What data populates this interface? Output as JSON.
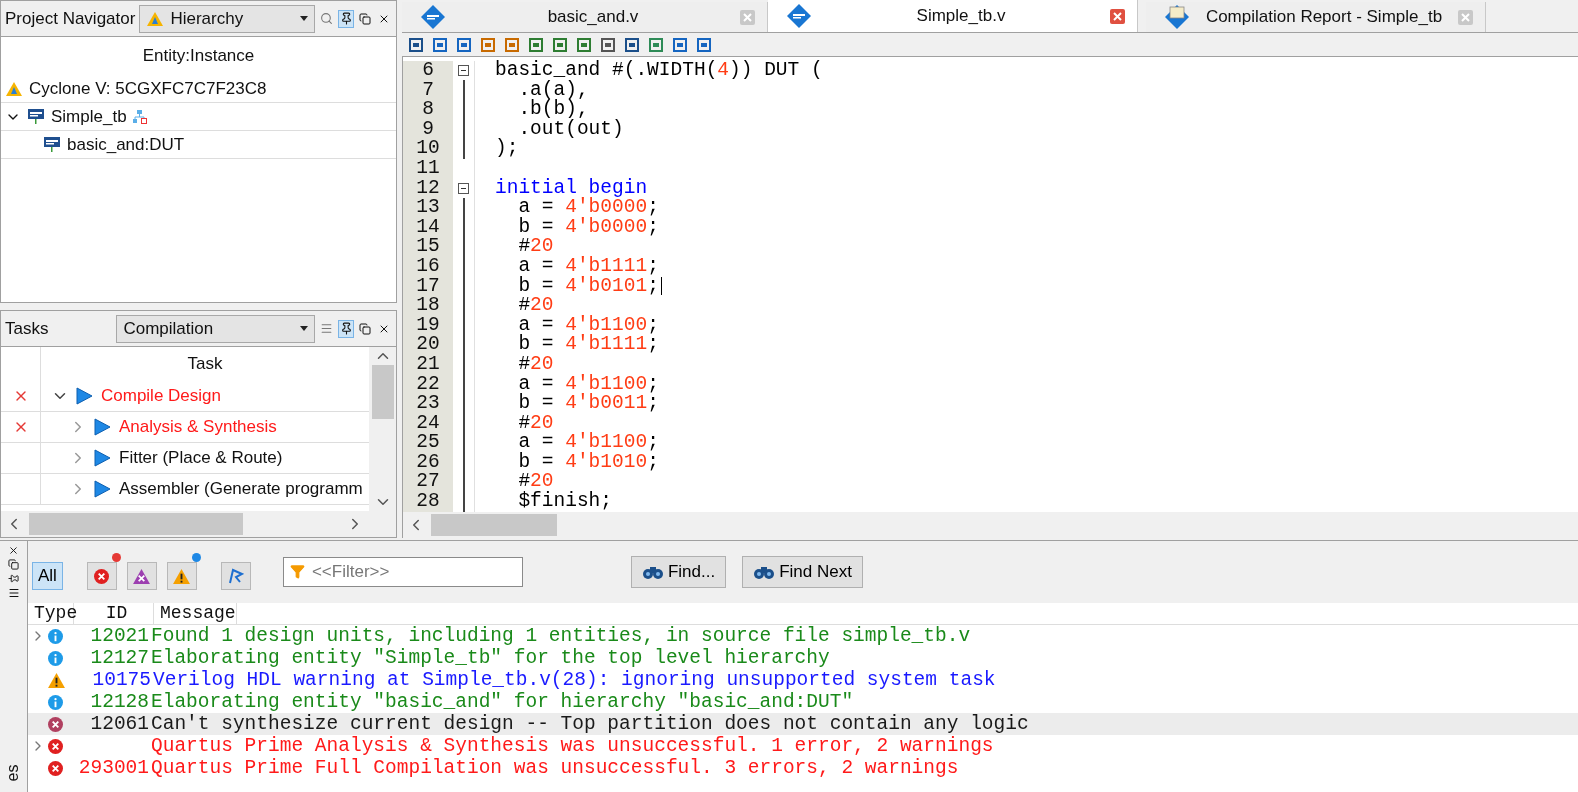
{
  "navigator": {
    "title": "Project Navigator",
    "view": "Hierarchy",
    "column": "Entity:Instance",
    "device": "Cyclone V: 5CGXFC7C7F23C8",
    "tree": [
      {
        "label": "Simple_tb",
        "expanded": true,
        "children": [
          {
            "label": "basic_and:DUT"
          }
        ]
      }
    ]
  },
  "tasks": {
    "title": "Tasks",
    "flow": "Compilation",
    "column": "Task",
    "tree": [
      {
        "label": "Compile Design",
        "failed": true,
        "expanded": true,
        "children": [
          {
            "label": "Analysis & Synthesis",
            "failed": true,
            "expanded": false
          },
          {
            "label": "Fitter (Place & Route)",
            "failed": false,
            "expanded": false
          },
          {
            "label": "Assembler (Generate programm",
            "failed": false,
            "expanded": false
          }
        ]
      }
    ]
  },
  "editor": {
    "tabs": [
      {
        "kind": "source",
        "label": "basic_and.v",
        "selected": false
      },
      {
        "kind": "source",
        "label": "Simple_tb.v",
        "selected": true
      },
      {
        "kind": "report",
        "label": "Compilation Report - Simple_tb",
        "selected": false
      }
    ],
    "lines": [
      {
        "number": "6",
        "kind": "start",
        "cursor": false,
        "tokens": [
          {
            "kind": "plain",
            "text": "basic_and #(.WIDTH("
          },
          {
            "kind": "number",
            "text": "4"
          },
          {
            "kind": "plain",
            "text": ")) DUT ("
          }
        ]
      },
      {
        "number": "7",
        "kind": "body",
        "cursor": false,
        "tokens": [
          {
            "kind": "plain",
            "text": "  .a(a),"
          }
        ]
      },
      {
        "number": "8",
        "kind": "body",
        "cursor": false,
        "tokens": [
          {
            "kind": "plain",
            "text": "  .b(b),"
          }
        ]
      },
      {
        "number": "9",
        "kind": "body",
        "cursor": false,
        "tokens": [
          {
            "kind": "plain",
            "text": "  .out(out)"
          }
        ]
      },
      {
        "number": "10",
        "kind": "body",
        "cursor": false,
        "tokens": [
          {
            "kind": "plain",
            "text": ");"
          }
        ]
      },
      {
        "number": "11",
        "kind": "none",
        "cursor": false
      },
      {
        "number": "12",
        "kind": "start",
        "cursor": false,
        "tokens": [
          {
            "kind": "keyword",
            "text": "initial begin"
          }
        ]
      },
      {
        "number": "13",
        "kind": "body",
        "cursor": false,
        "tokens": [
          {
            "kind": "plain",
            "text": "  a = "
          },
          {
            "kind": "number",
            "text": "4'b0000"
          },
          {
            "kind": "plain",
            "text": ";"
          }
        ]
      },
      {
        "number": "14",
        "kind": "body",
        "cursor": false,
        "tokens": [
          {
            "kind": "plain",
            "text": "  b = "
          },
          {
            "kind": "number",
            "text": "4'b0000"
          },
          {
            "kind": "plain",
            "text": ";"
          }
        ]
      },
      {
        "number": "15",
        "kind": "body",
        "cursor": false,
        "tokens": [
          {
            "kind": "plain",
            "text": "  #"
          },
          {
            "kind": "number",
            "text": "20"
          }
        ]
      },
      {
        "number": "16",
        "kind": "body",
        "cursor": false,
        "tokens": [
          {
            "kind": "plain",
            "text": "  a = "
          },
          {
            "kind": "number",
            "text": "4'b1111"
          },
          {
            "kind": "plain",
            "text": ";"
          }
        ]
      },
      {
        "number": "17",
        "kind": "body",
        "cursor": true,
        "tokens": [
          {
            "kind": "plain",
            "text": "  b = "
          },
          {
            "kind": "number",
            "text": "4'b0101"
          },
          {
            "kind": "plain",
            "text": ";"
          }
        ]
      },
      {
        "number": "18",
        "kind": "body",
        "cursor": false,
        "tokens": [
          {
            "kind": "plain",
            "text": "  #"
          },
          {
            "kind": "number",
            "text": "20"
          }
        ]
      },
      {
        "number": "19",
        "kind": "body",
        "cursor": false,
        "tokens": [
          {
            "kind": "plain",
            "text": "  a = "
          },
          {
            "kind": "number",
            "text": "4'b1100"
          },
          {
            "kind": "plain",
            "text": ";"
          }
        ]
      },
      {
        "number": "20",
        "kind": "body",
        "cursor": false,
        "tokens": [
          {
            "kind": "plain",
            "text": "  b = "
          },
          {
            "kind": "number",
            "text": "4'b1111"
          },
          {
            "kind": "plain",
            "text": ";"
          }
        ]
      },
      {
        "number": "21",
        "kind": "body",
        "cursor": false,
        "tokens": [
          {
            "kind": "plain",
            "text": "  #"
          },
          {
            "kind": "number",
            "text": "20"
          }
        ]
      },
      {
        "number": "22",
        "kind": "body",
        "cursor": false,
        "tokens": [
          {
            "kind": "plain",
            "text": "  a = "
          },
          {
            "kind": "number",
            "text": "4'b1100"
          },
          {
            "kind": "plain",
            "text": ";"
          }
        ]
      },
      {
        "number": "23",
        "kind": "body",
        "cursor": false,
        "tokens": [
          {
            "kind": "plain",
            "text": "  b = "
          },
          {
            "kind": "number",
            "text": "4'b0011"
          },
          {
            "kind": "plain",
            "text": ";"
          }
        ]
      },
      {
        "number": "24",
        "kind": "body",
        "cursor": false,
        "tokens": [
          {
            "kind": "plain",
            "text": "  #"
          },
          {
            "kind": "number",
            "text": "20"
          }
        ]
      },
      {
        "number": "25",
        "kind": "body",
        "cursor": false,
        "tokens": [
          {
            "kind": "plain",
            "text": "  a = "
          },
          {
            "kind": "number",
            "text": "4'b1100"
          },
          {
            "kind": "plain",
            "text": ";"
          }
        ]
      },
      {
        "number": "26",
        "kind": "body",
        "cursor": false,
        "tokens": [
          {
            "kind": "plain",
            "text": "  b = "
          },
          {
            "kind": "number",
            "text": "4'b1010"
          },
          {
            "kind": "plain",
            "text": ";"
          }
        ]
      },
      {
        "number": "27",
        "kind": "body",
        "cursor": false,
        "tokens": [
          {
            "kind": "plain",
            "text": "  #"
          },
          {
            "kind": "number",
            "text": "20"
          }
        ]
      },
      {
        "number": "28",
        "kind": "body",
        "cursor": false,
        "tokens": [
          {
            "kind": "plain",
            "text": "  $finish;"
          }
        ]
      }
    ]
  },
  "messages": {
    "side_label": "es",
    "filters": [
      {
        "kind": "all",
        "label": "All",
        "selected": true
      },
      {
        "kind": "error",
        "selected": false,
        "color": "#e53935"
      },
      {
        "kind": "critical",
        "selected": false
      },
      {
        "kind": "warning",
        "selected": false,
        "color": "#1e88e5"
      },
      {
        "kind": "flag",
        "selected": false
      }
    ],
    "filter_field": {
      "placeholder": "<<Filter>>"
    },
    "buttons": [
      "Find...",
      "Find Next"
    ],
    "columns": [
      "Type",
      "ID",
      "Message"
    ],
    "rows": [
      {
        "kind": "info",
        "expandable": true,
        "selected": false,
        "id": "12021",
        "text": "Found 1 design units, including 1 entities, in source file simple_tb.v",
        "color": "#1a8a1a"
      },
      {
        "kind": "info",
        "expandable": false,
        "selected": false,
        "id": "12127",
        "text": "Elaborating entity \"Simple_tb\" for the top level hierarchy",
        "color": "#1a8a1a"
      },
      {
        "kind": "warning",
        "expandable": false,
        "selected": false,
        "id": "10175",
        "text": "Verilog HDL warning at Simple_tb.v(28): ignoring unsupported system task",
        "color": "#1a1aff"
      },
      {
        "kind": "info",
        "expandable": false,
        "selected": false,
        "id": "12128",
        "text": "Elaborating entity \"basic_and\" for hierarchy \"basic_and:DUT\"",
        "color": "#1a8a1a"
      },
      {
        "kind": "critical",
        "expandable": false,
        "selected": true,
        "id": "12061",
        "text": "Can't synthesize current design -- Top partition does not contain any logic",
        "color": "#1a1a1a"
      },
      {
        "kind": "error",
        "expandable": true,
        "selected": false,
        "text": "Quartus Prime Analysis & Synthesis was unsuccessful. 1 error, 2 warnings",
        "color": "#ff1a1a"
      },
      {
        "kind": "error",
        "expandable": false,
        "selected": false,
        "id": "293001",
        "text": "Quartus Prime Full Compilation was unsuccessful. 3 errors, 2 warnings",
        "color": "#ff1a1a"
      }
    ]
  }
}
